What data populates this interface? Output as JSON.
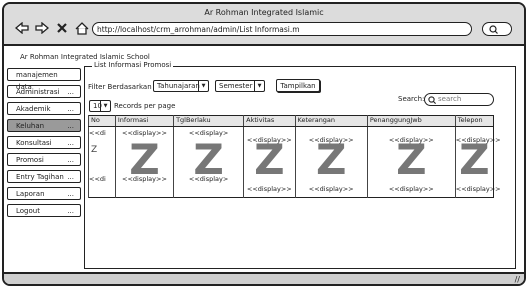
{
  "window": {
    "title": "Ar Rohman Integrated Islamic",
    "url": "http://localhost/crm_arrohman/admin/List Informasi.m"
  },
  "app_title": "Ar Rohman Integrated Islamic School",
  "sidebar": {
    "items": [
      {
        "label": "manajemen data",
        "more": ""
      },
      {
        "label": "Administrasi",
        "more": "..."
      },
      {
        "label": "Akademik",
        "more": "..."
      },
      {
        "label": "Keluhan",
        "more": "...",
        "active": true
      },
      {
        "label": "Konsultasi",
        "more": "..."
      },
      {
        "label": "Promosi",
        "more": "..."
      },
      {
        "label": "Entry Tagihan",
        "more": "..."
      },
      {
        "label": "Laporan",
        "more": "..."
      },
      {
        "label": "Logout",
        "more": "..."
      }
    ]
  },
  "panel": {
    "legend": "List Informasi Promosi"
  },
  "filter": {
    "label": "Filter Berdasarkan",
    "tahun": "Tahunajaran",
    "semester": "Semester",
    "button": "Tampilkan"
  },
  "perpage": {
    "value": "10",
    "label": "Records per page"
  },
  "search": {
    "label": "Search:",
    "placeholder": "search"
  },
  "table": {
    "headers": [
      "No",
      "Informasi",
      "TglBerlaku",
      "Aktivitas",
      "Keterangan",
      "PenanggungJwb",
      "Telepon"
    ],
    "row_top": [
      "<<di",
      "<<display>>",
      "<<display>",
      "<<display>>",
      "<<display>>",
      "<<display>>",
      "<<display>>"
    ],
    "row_mid": [
      "Z",
      "Z",
      "Z",
      "Z",
      "Z",
      "Z",
      "Z"
    ],
    "row_bottom": [
      "<<di",
      "<<display>>",
      "<<display>",
      "<<display>>",
      "<<display>>",
      "<<display>>",
      "<<display>>"
    ]
  }
}
